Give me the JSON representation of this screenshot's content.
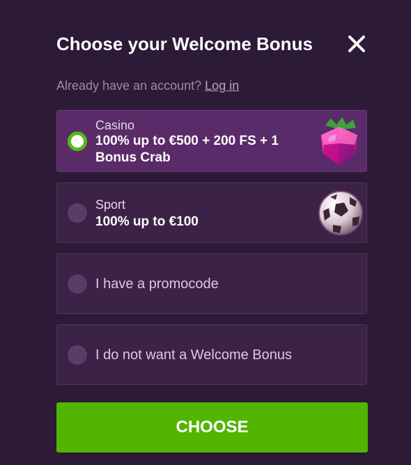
{
  "modal": {
    "title": "Choose your Welcome Bonus",
    "close_icon": "close-icon"
  },
  "login": {
    "prompt": "Already have an account?",
    "link": "Log in"
  },
  "options": [
    {
      "label": "Casino",
      "desc": "100% up to €500 + 200 FS + 1 Bonus Crab",
      "selected": true,
      "icon": "raspberry-icon"
    },
    {
      "label": "Sport",
      "desc": "100% up to €100",
      "selected": false,
      "icon": "soccer-ball-icon"
    },
    {
      "label": "I have a promocode",
      "selected": false
    },
    {
      "label": "I do not want a Welcome Bonus",
      "selected": false
    }
  ],
  "button": {
    "choose_label": "CHOOSE"
  },
  "colors": {
    "background": "#2d1a36",
    "selected_card": "#5a2b69",
    "card": "#3c2246",
    "accent_green": "#52b500"
  }
}
